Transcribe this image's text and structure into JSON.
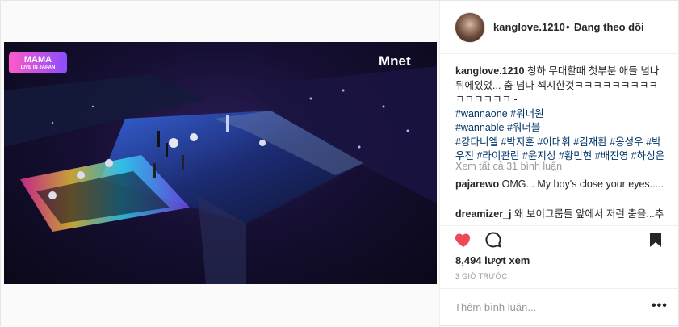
{
  "video": {
    "logo_left": "MAMA",
    "logo_left_sub": "LIVE IN JAPAN",
    "logo_right": "Mnet"
  },
  "header": {
    "username": "kanglove.1210",
    "separator": "•",
    "follow_status": "Đang theo dõi"
  },
  "caption": {
    "username": "kanglove.1210",
    "text": "청하 무대할때 첫부분 애들 넘나 뒤에있었... 춤 넘나 섹시한것ㅋㅋㅋㅋㅋㅋㅋㅋㅋㅋㅋㅋㅋㅋㅋ -",
    "tag_line_1": "#wannaone #워너원",
    "tag_line_2": "#wannable #워너블",
    "tag_line_3": "#강다니엘 #박지훈 #이대휘 #김재환 #옹성우 #박우진 #라이관린 #윤지성 #황민현 #배진영 #하성운"
  },
  "view_all_comments": "Xem tất cả 31 bình luận",
  "comments": [
    {
      "username": "pajarewo",
      "text": "OMG... My boy's close your eyes....."
    },
    {
      "username": "dreamizer_j",
      "text": "왜 보이그룹들 앞에서 저런 춤을...추"
    }
  ],
  "actions": {
    "like_icon": "heart-icon",
    "comment_icon": "comment-icon",
    "save_icon": "bookmark-icon",
    "like_color": "#ed4956"
  },
  "stats": {
    "views": "8,494 lượt xem",
    "time": "3 GIỜ TRƯỚC"
  },
  "add_comment": {
    "placeholder": "Thêm bình luận...",
    "more_label": "•••"
  }
}
